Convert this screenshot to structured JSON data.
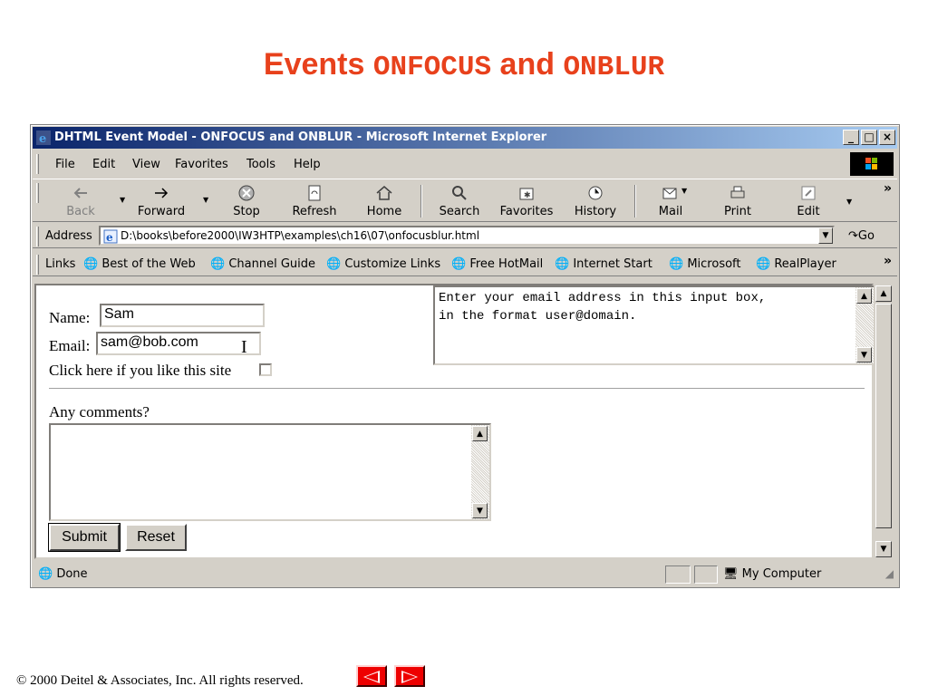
{
  "slide": {
    "title_prefix": "Events",
    "title_code1": "ONFOCUS",
    "title_mid": "and",
    "title_code2": "ONBLUR",
    "copyright": "© 2000 Deitel & Associates, Inc.  All rights reserved."
  },
  "window": {
    "title": "DHTML Event Model - ONFOCUS and ONBLUR - Microsoft Internet Explorer",
    "buttons": [
      "_",
      "□",
      "×"
    ]
  },
  "menu": [
    "File",
    "Edit",
    "View",
    "Favorites",
    "Tools",
    "Help"
  ],
  "toolbar": {
    "back": "Back",
    "forward": "Forward",
    "stop": "Stop",
    "refresh": "Refresh",
    "home": "Home",
    "search": "Search",
    "favorites": "Favorites",
    "history": "History",
    "mail": "Mail",
    "print": "Print",
    "edit": "Edit"
  },
  "address": {
    "label": "Address",
    "value": "D:\\books\\before2000\\IW3HTP\\examples\\ch16\\07\\onfocusblur.html",
    "go": "Go"
  },
  "links": {
    "label": "Links",
    "items": [
      "Best of the Web",
      "Channel Guide",
      "Customize Links",
      "Free HotMail",
      "Internet Start",
      "Microsoft",
      "RealPlayer"
    ]
  },
  "form": {
    "name_label": "Name:",
    "name_value": "Sam",
    "email_label": "Email:",
    "email_value": "sam@bob.com",
    "like_label": "Click here if you like this site",
    "help_line1": "Enter your email address in this input box,",
    "help_line2": "in the format user@domain.",
    "comments_label": "Any comments?",
    "submit": "Submit",
    "reset": "Reset"
  },
  "status": {
    "text": "Done",
    "zone": "My Computer"
  },
  "colors": {
    "title_red": "#e8411c",
    "titlebar_start": "#0a246a",
    "titlebar_end": "#a6caf0",
    "chrome": "#d4d0c8"
  }
}
